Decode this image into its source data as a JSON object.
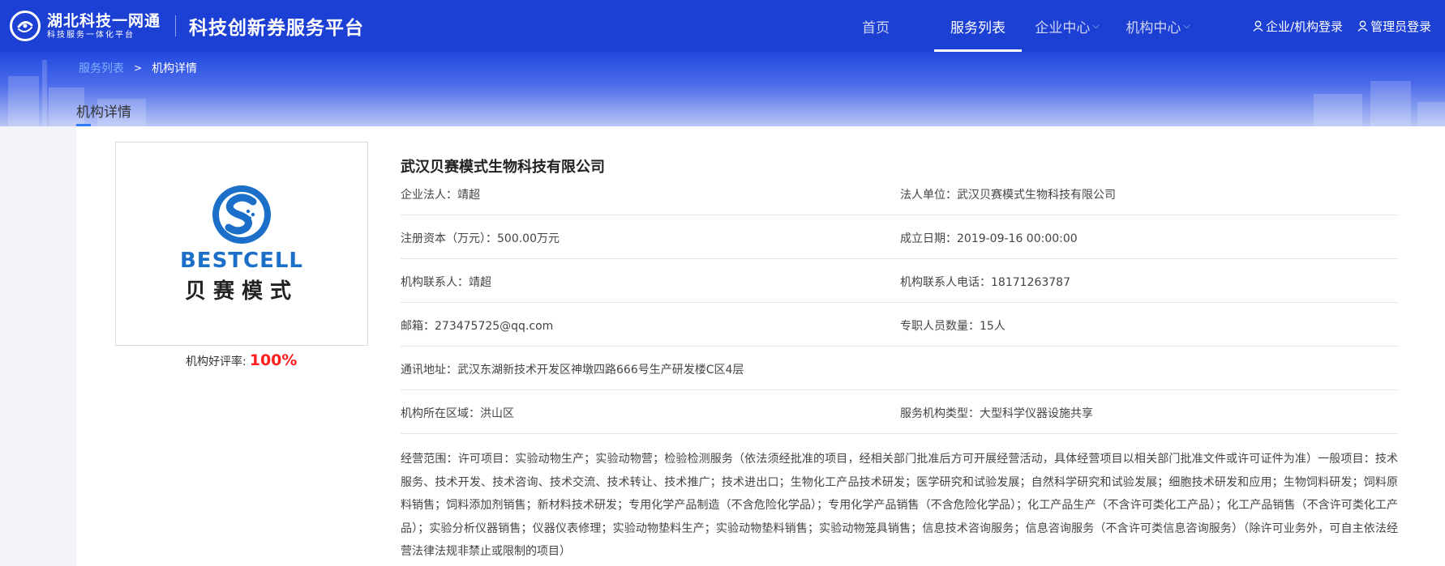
{
  "header": {
    "logo_title": "湖北科技一网通",
    "logo_sub": "科技服务一体化平台",
    "platform_title": "科技创新券服务平台",
    "nav": [
      {
        "label": "首页",
        "dropdown": false,
        "active": false
      },
      {
        "label": "服务列表",
        "dropdown": false,
        "active": true
      },
      {
        "label": "企业中心",
        "dropdown": true,
        "active": false
      },
      {
        "label": "机构中心",
        "dropdown": true,
        "active": false
      }
    ],
    "login_org": "企业/机构登录",
    "login_admin": "管理员登录"
  },
  "breadcrumb": {
    "parent": "服务列表",
    "separator": ">",
    "current": "机构详情"
  },
  "section_title": "机构详情",
  "org": {
    "brand_en": "BESTCELL",
    "brand_cn": "贝赛模式",
    "rating_label": "机构好评率:",
    "rating_value": "100%",
    "name": "武汉贝赛模式生物科技有限公司",
    "rows": [
      {
        "left": "企业法人：靖超",
        "right": "法人单位：武汉贝赛模式生物科技有限公司"
      },
      {
        "left": "注册资本（万元）：500.00万元",
        "right": "成立日期：2019-09-16 00:00:00"
      },
      {
        "left": "机构联系人：靖超",
        "right": "机构联系人电话：18171263787"
      },
      {
        "left": "邮箱：273475725@qq.com",
        "right": "专职人员数量：15人"
      },
      {
        "left": "通讯地址：武汉东湖新技术开发区神墩四路666号生产研发楼C区4层",
        "right": ""
      },
      {
        "left": "机构所在区域：洪山区",
        "right": "服务机构类型：大型科学仪器设施共享"
      }
    ],
    "scope": "经营范围：许可项目：实验动物生产；实验动物营；检验检测服务（依法须经批准的项目，经相关部门批准后方可开展经营活动，具体经营项目以相关部门批准文件或许可证件为准）一般项目：技术服务、技术开发、技术咨询、技术交流、技术转让、技术推广；技术进出口；生物化工产品技术研发；医学研究和试验发展；自然科学研究和试验发展；细胞技术研发和应用；生物饲料研发；饲料原料销售；饲料添加剂销售；新材料技术研发；专用化学产品制造（不含危险化学品）；专用化学产品销售（不含危险化学品）；化工产品生产（不含许可类化工产品）；化工产品销售（不含许可类化工产品）；实验分析仪器销售；仪器仪表修理；实验动物垫料生产；实验动物垫料销售；实验动物笼具销售；信息技术咨询服务；信息咨询服务（不含许可类信息咨询服务）（除许可业务外，可自主依法经营法律法规非禁止或限制的项目）"
  },
  "colors": {
    "header_bg": "#1c3fd4",
    "accent": "#2f7df6",
    "rating": "#ff1f1f",
    "brand_blue": "#1b6fc9"
  }
}
